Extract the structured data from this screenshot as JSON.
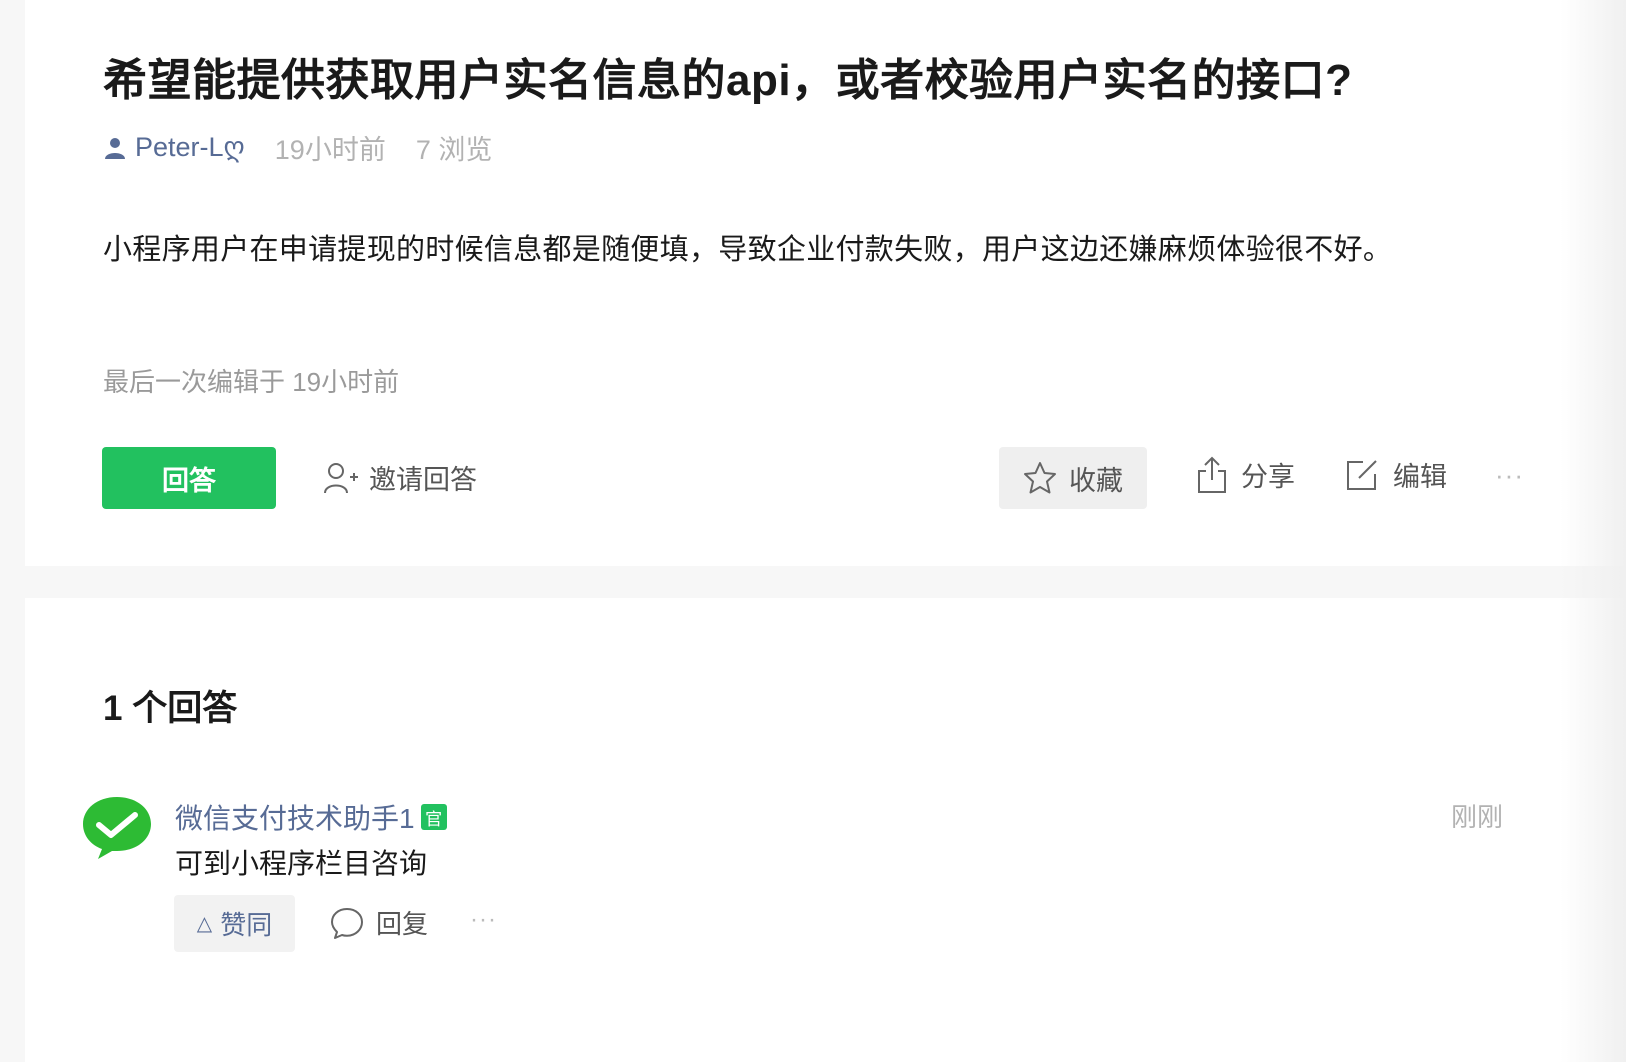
{
  "question": {
    "title": "希望能提供获取用户实名信息的api，或者校验用户实名的接口?",
    "author": "Peter-L",
    "author_emoji": "ღ",
    "time": "19小时前",
    "views": "7 浏览",
    "body": "小程序用户在申请提现的时候信息都是随便填，导致企业付款失败，用户这边还嫌麻烦体验很不好。",
    "edited": "最后一次编辑于  19小时前"
  },
  "actions": {
    "answer_label": "回答",
    "invite_label": "邀请回答",
    "favorite_label": "收藏",
    "share_label": "分享",
    "edit_label": "编辑",
    "more_label": "···"
  },
  "answers": {
    "count_label": "1 个回答",
    "items": [
      {
        "author": "微信支付技术助手1",
        "badge": "官",
        "time": "刚刚",
        "body": "可到小程序栏目咨询",
        "like_label": "赞同",
        "reply_label": "回复",
        "more_label": "···"
      }
    ]
  },
  "colors": {
    "brand_green": "#22c15f",
    "link_blue": "#576b95",
    "muted_gray": "#b2b2b2"
  },
  "icons": {
    "author": "user-icon",
    "invite": "add-user-icon",
    "favorite": "star-icon",
    "share": "share-icon",
    "edit": "edit-icon",
    "reply": "comment-icon",
    "like": "triangle-up-icon",
    "avatar": "wechat-pay-logo"
  }
}
